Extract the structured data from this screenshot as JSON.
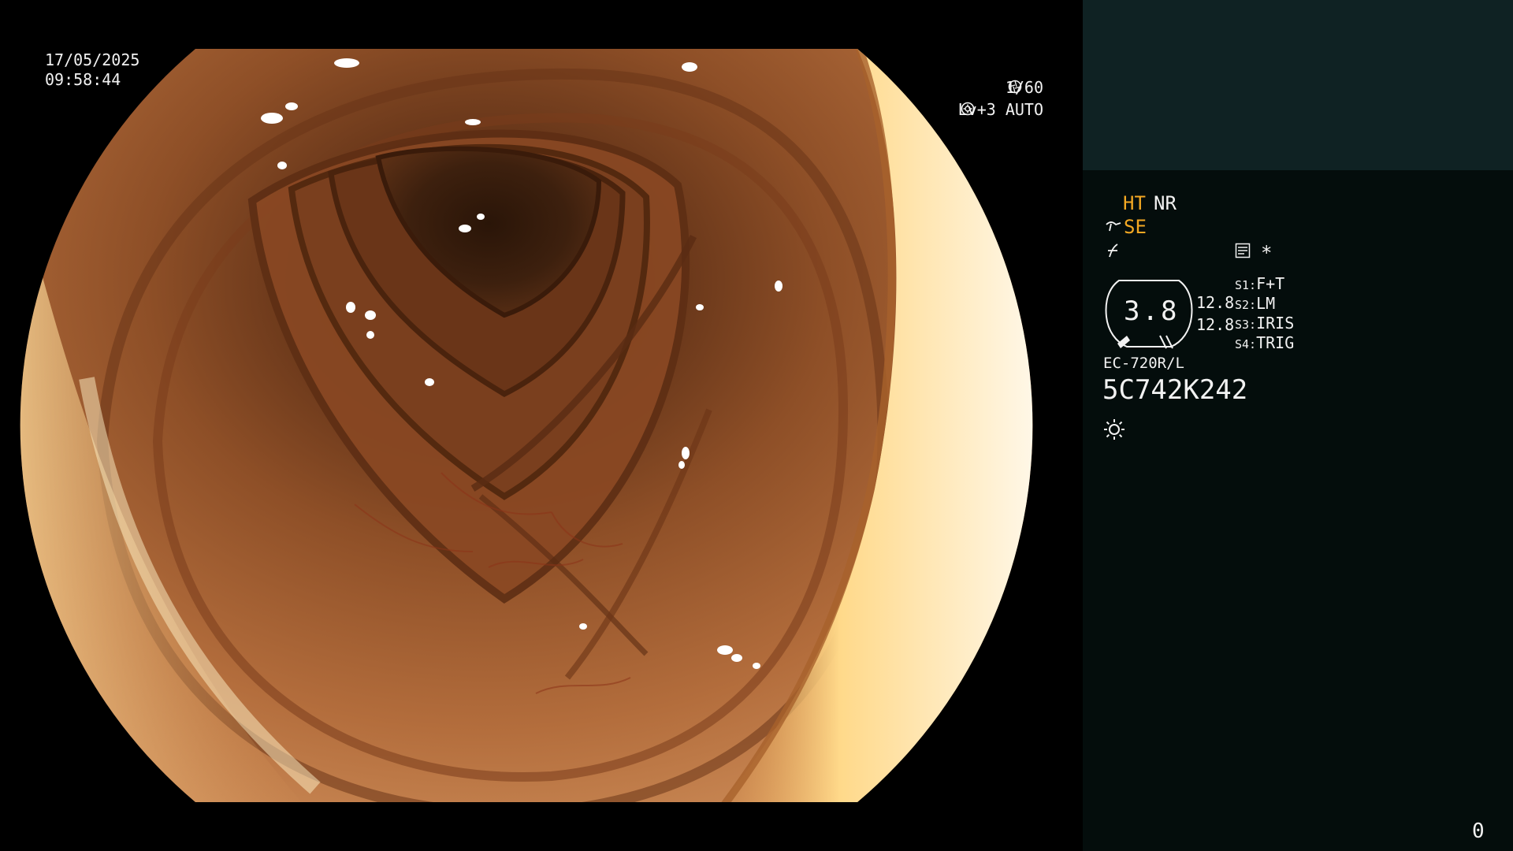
{
  "overlay": {
    "date": "17/05/2025",
    "time": "09:58:44",
    "shutter": "1/60",
    "level": "Lv+3 AUTO",
    "shutter_icon": "aperture-icon",
    "level_icon": "flower-icon"
  },
  "panel": {
    "ht": "HT",
    "nr": "NR",
    "se": "SE",
    "se_icon": "structure-enhance-icon",
    "f_icon": "freeze-icon",
    "doc_icon": "document-icon",
    "star": "*",
    "gauge_value": "3.8",
    "readout1": "12.8",
    "readout2": "12.8",
    "slots": [
      {
        "key": "S1:",
        "value": "F+T"
      },
      {
        "key": "S2:",
        "value": "LM"
      },
      {
        "key": "S3:",
        "value": "IRIS"
      },
      {
        "key": "S4:",
        "value": "TRIG"
      }
    ],
    "model": "EC-720R/L",
    "serial": "5C742K242",
    "light_icon": "sun-icon",
    "corner_count": "0"
  },
  "colors": {
    "accent": "#f3a823",
    "panel_top": "#0f2223",
    "panel_bottom": "#040d0c"
  }
}
